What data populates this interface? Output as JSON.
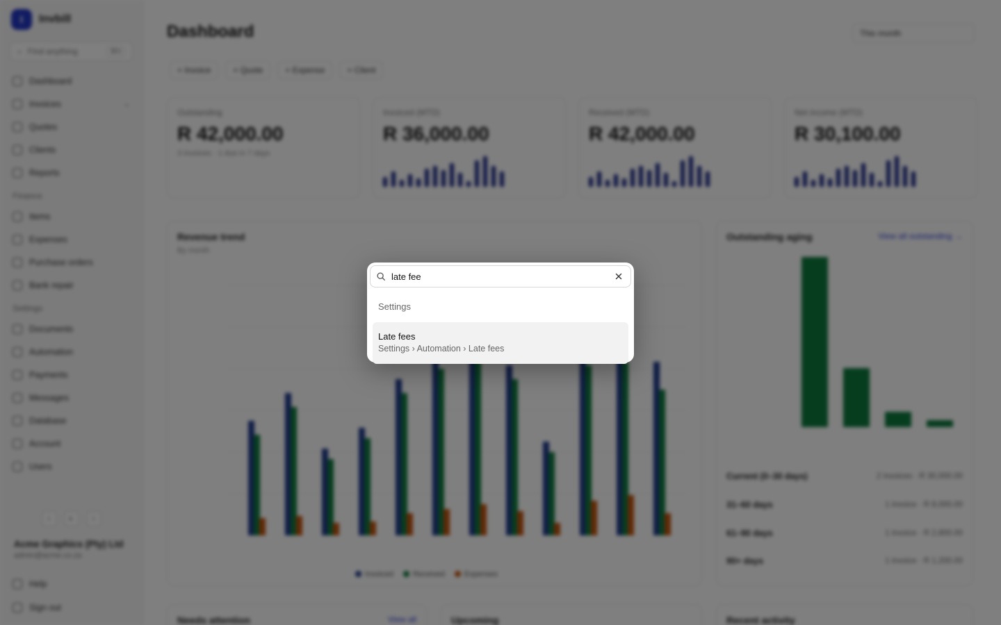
{
  "app": {
    "brand": {
      "initial": "I",
      "name": "Invbill"
    },
    "sidebar_search": {
      "placeholder": "Find anything",
      "shortcut": "⌘K"
    },
    "nav_main": [
      {
        "label": "Dashboard",
        "icon": "home-icon"
      },
      {
        "label": "Invoices",
        "icon": "invoice-icon",
        "expandable": true
      },
      {
        "label": "Quotes",
        "icon": "quote-icon"
      },
      {
        "label": "Clients",
        "icon": "users-icon"
      },
      {
        "label": "Reports",
        "icon": "chart-icon"
      }
    ],
    "nav_finance_label": "Finance",
    "nav_finance": [
      {
        "label": "Items",
        "icon": "box-icon"
      },
      {
        "label": "Expenses",
        "icon": "receipt-icon"
      },
      {
        "label": "Purchase orders",
        "icon": "cart-icon"
      },
      {
        "label": "Bank repair",
        "icon": "bank-icon"
      }
    ],
    "nav_settings_label": "Settings",
    "nav_settings": [
      {
        "label": "Documents",
        "icon": "document-icon"
      },
      {
        "label": "Automation",
        "icon": "automation-icon"
      },
      {
        "label": "Payments",
        "icon": "card-icon"
      },
      {
        "label": "Messages",
        "icon": "mail-icon"
      },
      {
        "label": "Database",
        "icon": "database-icon"
      },
      {
        "label": "Account",
        "icon": "user-icon"
      },
      {
        "label": "Users",
        "icon": "users-icon"
      }
    ],
    "org": {
      "name": "Acme Graphics (Pty) Ltd",
      "email": "admin@acme.co.za"
    },
    "bottom_nav": [
      {
        "label": "Help",
        "icon": "help-icon"
      },
      {
        "label": "Sign out",
        "icon": "logout-icon"
      }
    ],
    "page_title": "Dashboard",
    "period_label": "This month",
    "quick_actions": [
      "+ Invoice",
      "+ Quote",
      "+ Expense",
      "+ Client"
    ],
    "kpis": [
      {
        "label": "Outstanding",
        "value": "R 42,000.00",
        "sub": "3 invoices · 1 due in 7 days"
      },
      {
        "label": "Invoiced (MTD)",
        "value": "R 36,000.00",
        "sub": ""
      },
      {
        "label": "Received (MTD)",
        "value": "R 42,000.00",
        "sub": ""
      },
      {
        "label": "Net income (MTD)",
        "value": "R 30,100.00",
        "sub": ""
      }
    ],
    "revenue_panel": {
      "title": "Revenue trend",
      "subtitle": "By month"
    },
    "revenue_legend": [
      {
        "label": "Invoiced",
        "color": "#1f3a8a"
      },
      {
        "label": "Received",
        "color": "#0f7a3e"
      },
      {
        "label": "Expenses",
        "color": "#c2520c"
      }
    ],
    "aging_panel": {
      "title": "Outstanding aging",
      "link": "View all outstanding →"
    },
    "aging_rows": [
      {
        "label": "Current (0–30 days)",
        "value": "2 invoices · R 30,000.00"
      },
      {
        "label": "31–60 days",
        "value": "1 invoice · R 8,000.00"
      },
      {
        "label": "61–90 days",
        "value": "1 invoice · R 2,800.00"
      },
      {
        "label": "90+ days",
        "value": "1 invoice · R 1,200.00"
      }
    ],
    "bottom_panels": [
      "Needs attention",
      "Upcoming",
      "Recent activity"
    ],
    "bottom_panel_link": "View all"
  },
  "palette": {
    "query": "late fee",
    "group_label": "Settings",
    "results": [
      {
        "title": "Late fees",
        "path": "Settings › Automation › Late fees"
      }
    ]
  }
}
